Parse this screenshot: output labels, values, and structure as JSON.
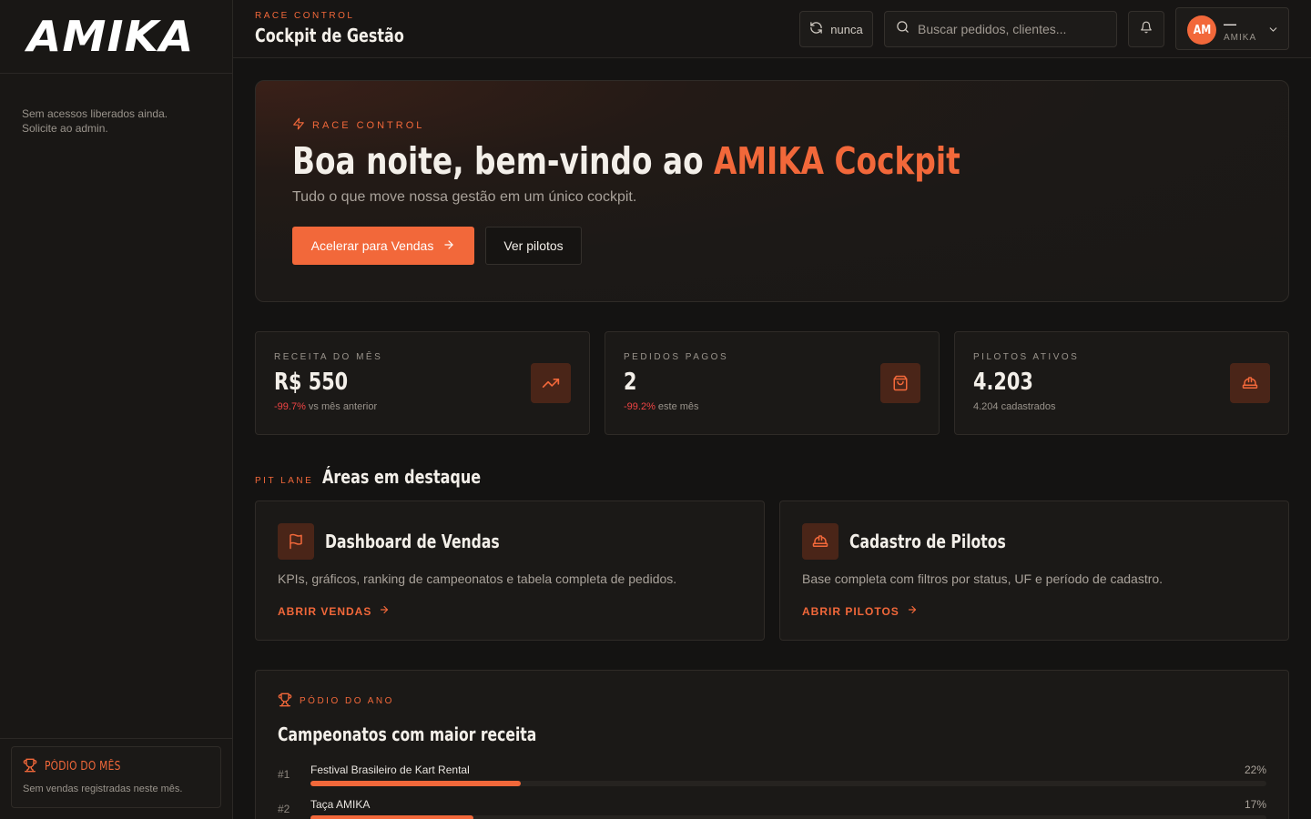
{
  "sidebar": {
    "logo": "AMIKA",
    "empty_line1": "Sem acessos liberados ainda.",
    "empty_line2": "Solicite ao admin.",
    "podium": {
      "title": "PÓDIO DO MÊS",
      "subtitle": "Sem vendas registradas neste mês."
    }
  },
  "header": {
    "kicker": "RACE CONTROL",
    "title": "Cockpit de Gestão",
    "sync_label": "nunca",
    "search_placeholder": "Buscar pedidos, clientes...",
    "user": {
      "initials": "AM",
      "name": "—",
      "org": "AMIKA"
    }
  },
  "hero": {
    "kicker": "RACE CONTROL",
    "title_prefix": "Boa noite, bem-vindo ao ",
    "title_accent": "AMIKA Cockpit",
    "subtitle": "Tudo o que move nossa gestão em um único cockpit.",
    "primary_button": "Acelerar para Vendas",
    "secondary_button": "Ver pilotos"
  },
  "kpis": [
    {
      "label": "RECEITA DO MÊS",
      "value": "R$ 550",
      "delta": "-99.7%",
      "note": "vs mês anterior",
      "icon": "trending-up-icon"
    },
    {
      "label": "PEDIDOS PAGOS",
      "value": "2",
      "delta": "-99.2%",
      "note": "este mês",
      "icon": "shopping-bag-icon"
    },
    {
      "label": "PILOTOS ATIVOS",
      "value": "4.203",
      "delta": "",
      "note": "4.204 cadastrados",
      "icon": "helmet-icon"
    }
  ],
  "areas_section": {
    "kicker": "PIT LANE",
    "title": "Áreas em destaque"
  },
  "areas": [
    {
      "title": "Dashboard de Vendas",
      "description": "KPIs, gráficos, ranking de campeonatos e tabela completa de pedidos.",
      "link": "ABRIR VENDAS",
      "icon": "flag-icon"
    },
    {
      "title": "Cadastro de Pilotos",
      "description": "Base completa com filtros por status, UF e período de cadastro.",
      "link": "ABRIR PILOTOS",
      "icon": "helmet-icon"
    }
  ],
  "podio": {
    "kicker": "PÓDIO DO ANO",
    "title": "Campeonatos com maior receita",
    "ranking": [
      {
        "rank": "#1",
        "name": "Festival Brasileiro de Kart Rental",
        "pct_label": "22%",
        "share": 0.22
      },
      {
        "rank": "#2",
        "name": "Taça AMIKA",
        "pct_label": "17%",
        "share": 0.17
      }
    ]
  },
  "colors": {
    "accent": "#f2683a",
    "negative": "#ef4444",
    "background": "#141312"
  }
}
